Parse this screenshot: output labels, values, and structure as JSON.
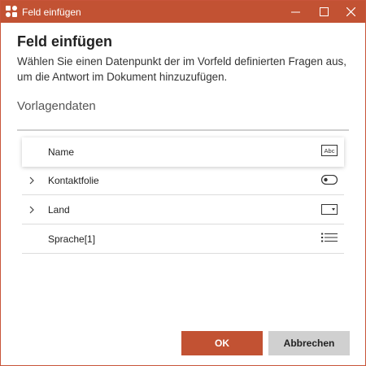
{
  "window": {
    "title": "Feld einfügen",
    "accent": "#c25233"
  },
  "dialog": {
    "heading": "Feld einfügen",
    "description": "Wählen Sie einen Datenpunkt der im Vorfeld definierten Fragen aus, um die Antwort im Dokument hinzuzufügen.",
    "section": "Vorlagendaten"
  },
  "fields": [
    {
      "label": "Name",
      "icon": "text-field-icon",
      "expandable": false,
      "selected": true
    },
    {
      "label": "Kontaktfolie",
      "icon": "toggle-icon",
      "expandable": true,
      "selected": false
    },
    {
      "label": "Land",
      "icon": "dropdown-icon",
      "expandable": true,
      "selected": false
    },
    {
      "label": "Sprache[1]",
      "icon": "list-icon",
      "expandable": false,
      "selected": false
    }
  ],
  "buttons": {
    "ok": "OK",
    "cancel": "Abbrechen"
  },
  "icons": {
    "text_field_text": "Abc"
  }
}
